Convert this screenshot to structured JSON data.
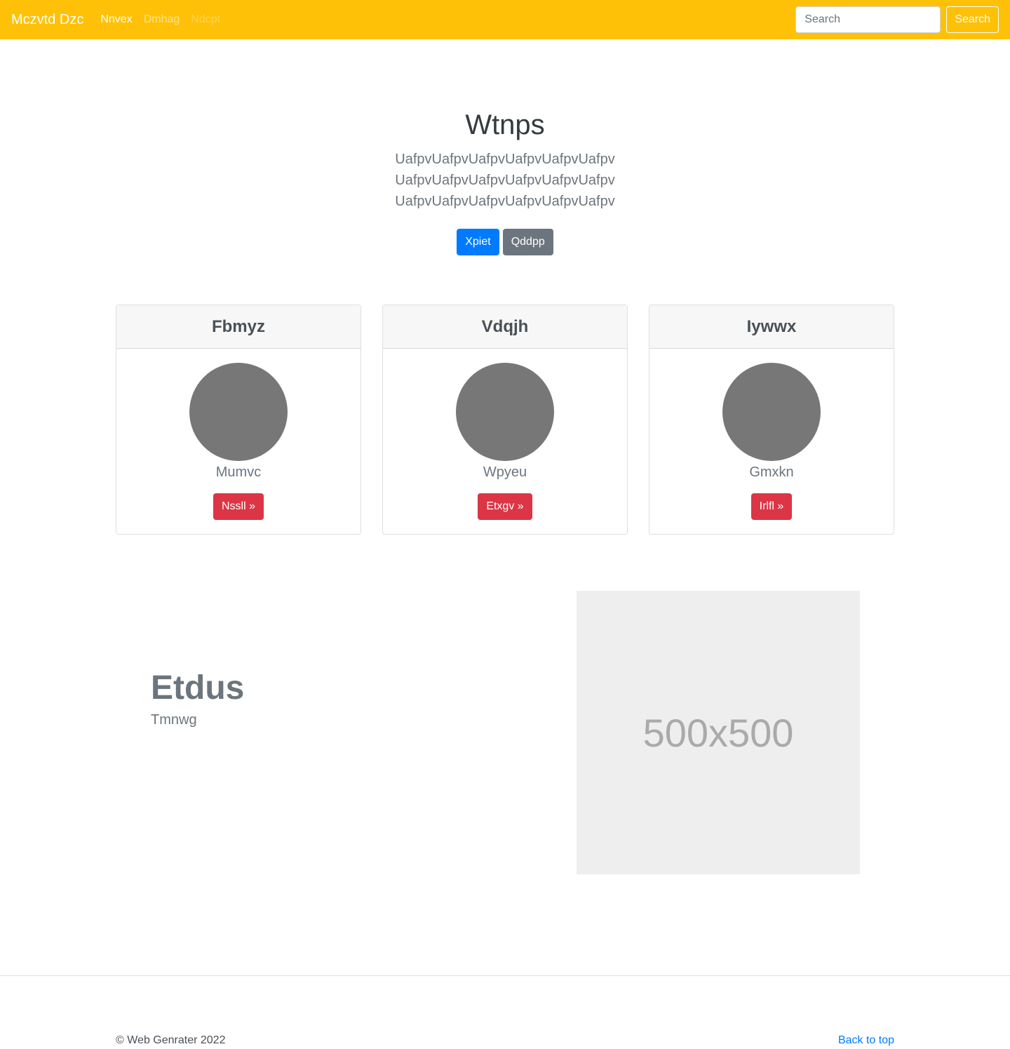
{
  "navbar": {
    "brand": "Mczvtd Dzc",
    "links": [
      {
        "label": "Nnvex",
        "state": "active"
      },
      {
        "label": "Dmhag",
        "state": "normal"
      },
      {
        "label": "Ndcpt",
        "state": "disabled"
      }
    ],
    "search_placeholder": "Search",
    "search_button": "Search"
  },
  "hero": {
    "title": "Wtnps",
    "lead": "UafpvUafpvUafpvUafpvUafpvUafpv UafpvUafpvUafpvUafpvUafpvUafpv UafpvUafpvUafpvUafpvUafpvUafpv",
    "primary_button": "Xpiet",
    "secondary_button": "Qddpp"
  },
  "cards": [
    {
      "title": "Fbmyz",
      "text": "Mumvc",
      "button": "Nssll »"
    },
    {
      "title": "Vdqjh",
      "text": "Wpyeu",
      "button": "Etxgv »"
    },
    {
      "title": "Iywwx",
      "text": "Gmxkn",
      "button": "Irlfl »"
    }
  ],
  "feature": {
    "heading": "Etdus",
    "subtext": "Tmnwg",
    "image_label": "500x500"
  },
  "footer": {
    "copyright": "© Web Genrater 2022",
    "back_to_top": "Back to top"
  },
  "colors": {
    "navbar": "#ffc107",
    "primary": "#007bff",
    "secondary": "#6c757d",
    "danger": "#dc3545",
    "avatar": "#777777",
    "placeholder": "#eeeeee"
  }
}
